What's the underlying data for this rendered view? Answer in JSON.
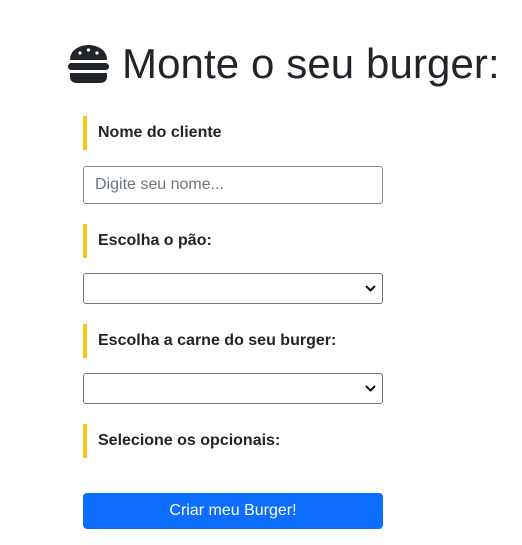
{
  "header": {
    "title": "Monte o seu burger:",
    "icon": "burger-icon"
  },
  "form": {
    "name_label": "Nome do cliente",
    "name_placeholder": "Digite seu nome...",
    "name_value": "",
    "bread_label": "Escolha o pão:",
    "bread_selected": "",
    "meat_label": "Escolha a carne do seu burger:",
    "meat_selected": "",
    "optionals_label": "Selecione os opcionais:",
    "submit_label": "Criar meu Burger!"
  },
  "colors": {
    "accent_bar": "#f5c518",
    "button_bg": "#0d6efd",
    "button_text": "#ffffff"
  }
}
